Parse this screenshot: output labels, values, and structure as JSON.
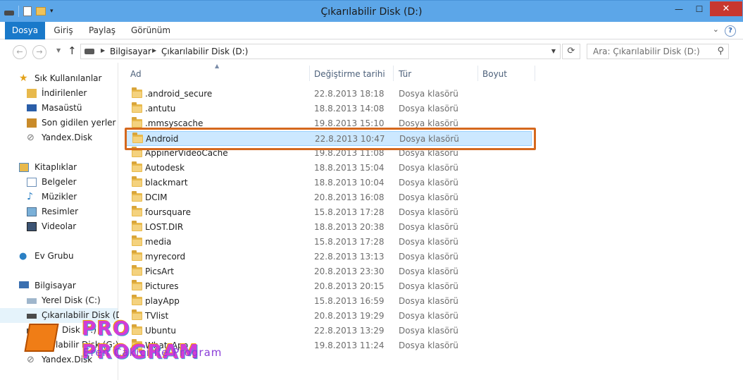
{
  "window": {
    "title": "Çıkarılabilir Disk (D:)",
    "close_label": "✕",
    "minimize_label": "—",
    "maximize_label": "☐"
  },
  "ribbon": {
    "tabs": [
      "Dosya",
      "Giriş",
      "Paylaş",
      "Görünüm"
    ],
    "help": "?"
  },
  "address": {
    "crumbs": [
      "Bilgisayar",
      "Çıkarılabilir Disk (D:)"
    ],
    "search_placeholder": "Ara: Çıkarılabilir Disk (D:)"
  },
  "nav": {
    "favorites_header": "Sık Kullanılanlar",
    "favorites": [
      "İndirilenler",
      "Masaüstü",
      "Son gidilen yerler",
      "Yandex.Disk"
    ],
    "libraries_header": "Kitaplıklar",
    "libraries": [
      "Belgeler",
      "Müzikler",
      "Resimler",
      "Videolar"
    ],
    "homegroup": "Ev Grubu",
    "computer_header": "Bilgisayar",
    "computer": [
      "Yerel Disk (C:)",
      "Çıkarılabilir Disk (D:)",
      "Disk (F:)",
      "labilir Disk (G:)",
      "Yandex.Disk"
    ]
  },
  "columns": {
    "name": "Ad",
    "date": "Değiştirme tarihi",
    "type": "Tür",
    "size": "Boyut"
  },
  "files": [
    {
      "name": ".android_secure",
      "date": "22.8.2013 18:18",
      "type": "Dosya klasörü"
    },
    {
      "name": ".antutu",
      "date": "18.8.2013 14:08",
      "type": "Dosya klasörü"
    },
    {
      "name": ".mmsyscache",
      "date": "19.8.2013 15:10",
      "type": "Dosya klasörü"
    },
    {
      "name": "Android",
      "date": "22.8.2013 10:47",
      "type": "Dosya klasörü"
    },
    {
      "name": "AppinerVideoCache",
      "date": "19.8.2013 11:08",
      "type": "Dosya klasörü"
    },
    {
      "name": "Autodesk",
      "date": "18.8.2013 15:04",
      "type": "Dosya klasörü"
    },
    {
      "name": "blackmart",
      "date": "18.8.2013 10:04",
      "type": "Dosya klasörü"
    },
    {
      "name": "DCIM",
      "date": "20.8.2013 16:08",
      "type": "Dosya klasörü"
    },
    {
      "name": "foursquare",
      "date": "15.8.2013 17:28",
      "type": "Dosya klasörü"
    },
    {
      "name": "LOST.DIR",
      "date": "18.8.2013 20:38",
      "type": "Dosya klasörü"
    },
    {
      "name": "media",
      "date": "15.8.2013 17:28",
      "type": "Dosya klasörü"
    },
    {
      "name": "myrecord",
      "date": "22.8.2013 13:13",
      "type": "Dosya klasörü"
    },
    {
      "name": "PicsArt",
      "date": "20.8.2013 23:30",
      "type": "Dosya klasörü"
    },
    {
      "name": "Pictures",
      "date": "20.8.2013 20:15",
      "type": "Dosya klasörü"
    },
    {
      "name": "playApp",
      "date": "15.8.2013 16:59",
      "type": "Dosya klasörü"
    },
    {
      "name": "TVlist",
      "date": "20.8.2013 19:29",
      "type": "Dosya klasörü"
    },
    {
      "name": "Ubuntu",
      "date": "22.8.2013 13:29",
      "type": "Dosya klasörü"
    },
    {
      "name": "WhatsApp",
      "date": "19.8.2013 11:24",
      "type": "Dosya klasörü"
    }
  ],
  "selected_file": "Android",
  "watermark": {
    "title": "PRO PROGRAM",
    "subtitle": "Eren Çakici İle Program"
  }
}
